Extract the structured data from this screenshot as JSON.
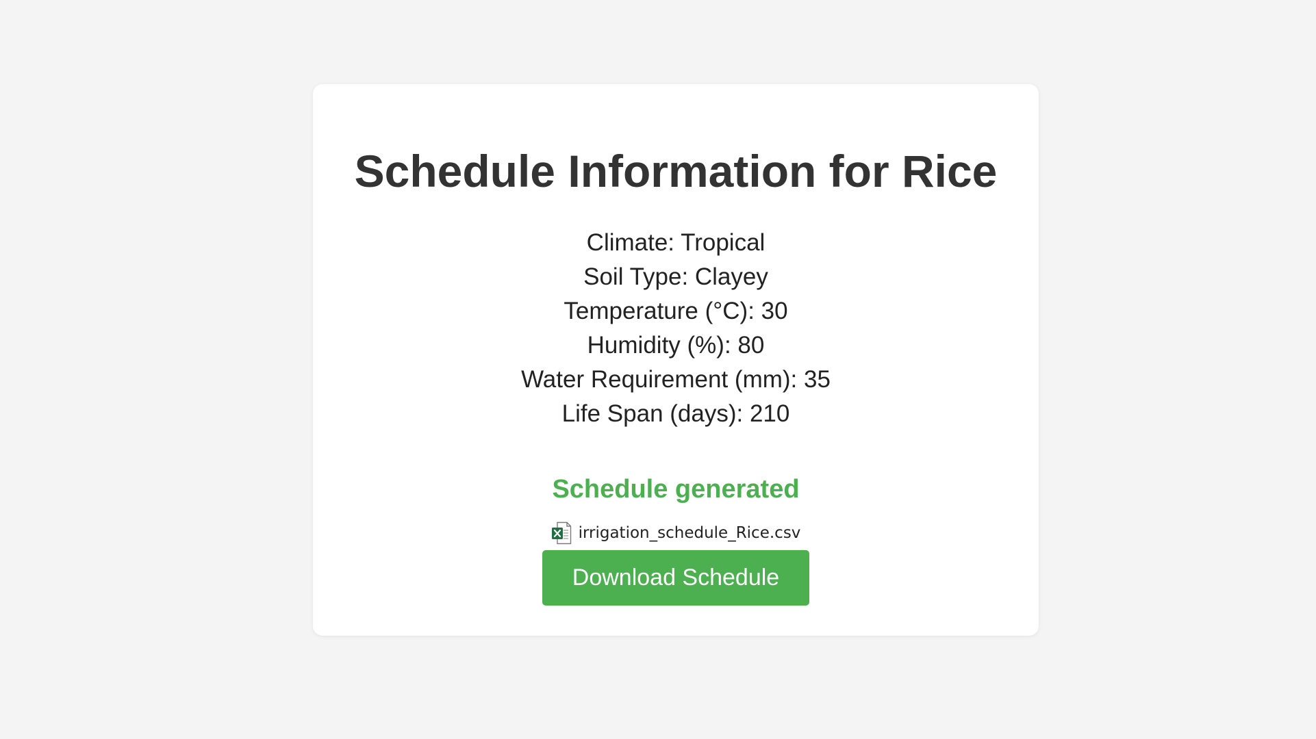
{
  "card": {
    "title": "Schedule Information for Rice",
    "info": [
      "Climate: Tropical",
      "Soil Type: Clayey",
      "Temperature (°C): 30",
      "Humidity (%): 80",
      "Water Requirement (mm): 35",
      "Life Span (days): 210"
    ],
    "status": "Schedule generated",
    "file": {
      "icon": "excel-file-icon",
      "name": "irrigation_schedule_Rice.csv"
    },
    "download_label": "Download Schedule"
  },
  "colors": {
    "background": "#f4f4f4",
    "card": "#ffffff",
    "accent_green": "#4caf50",
    "title_text": "#333333"
  }
}
